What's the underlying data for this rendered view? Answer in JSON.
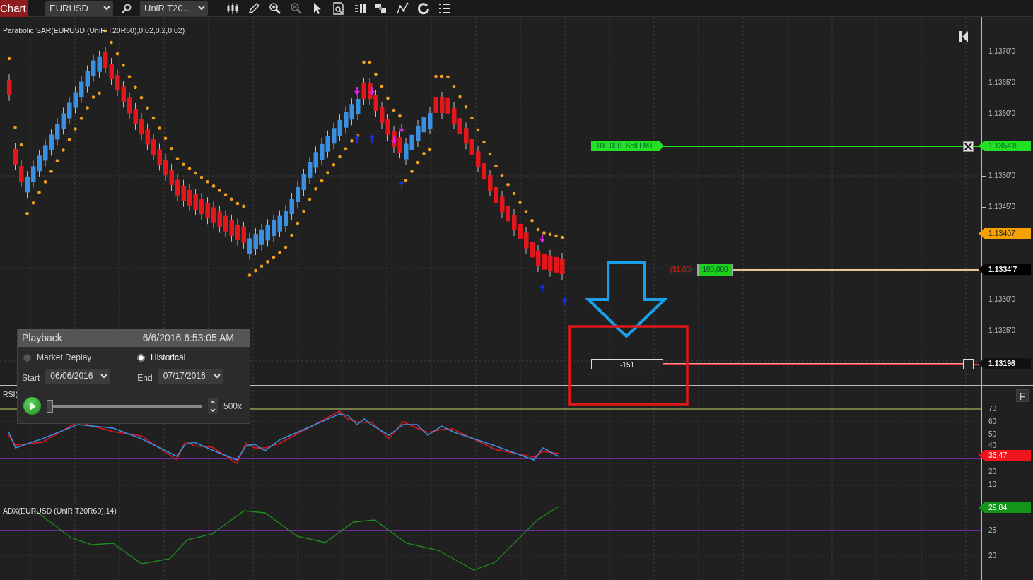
{
  "toolbar": {
    "tab": "Chart",
    "instrument": "EURUSD",
    "bar_type": "UniR T20..."
  },
  "price_panel": {
    "indicator_label": "Parabolic SAR(EURUSD (UniR T20R60),0.02,0.2,0.02)",
    "axis_ticks": [
      "1.1370'0",
      "1.1365'0",
      "1.1360'0",
      "1.1350'0",
      "1.1345'0",
      "1.1330'0",
      "1.1325'0"
    ],
    "last_price": "1.13407",
    "orders": [
      {
        "kind": "limit",
        "label": "100,000  Sell LMT",
        "price": "1.1354'8"
      },
      {
        "kind": "position",
        "pnl": "($1.00)",
        "quantity": "100,000",
        "price": "1.1334'7"
      },
      {
        "kind": "stop",
        "label": "-151",
        "price": "1.13196"
      }
    ]
  },
  "rsi_panel": {
    "label": "RSI(",
    "button": "F",
    "axis_ticks": [
      "70",
      "60",
      "50",
      "40",
      "20",
      "10"
    ],
    "value": "33.47"
  },
  "adx_panel": {
    "label": "ADX(EURUSD (UniR T20R60),14)",
    "axis_ticks": [
      "25",
      "20"
    ],
    "value": "29.84"
  },
  "playback": {
    "title": "Playback",
    "time": "6/6/2016 6:53:05 AM",
    "modes": [
      {
        "label": "Market Replay",
        "selected": false
      },
      {
        "label": "Historical",
        "selected": true
      }
    ],
    "start_label": "Start",
    "start": "06/06/2016",
    "end_label": "End",
    "end": "07/17/2016",
    "level": 0,
    "speed": "500x"
  }
}
